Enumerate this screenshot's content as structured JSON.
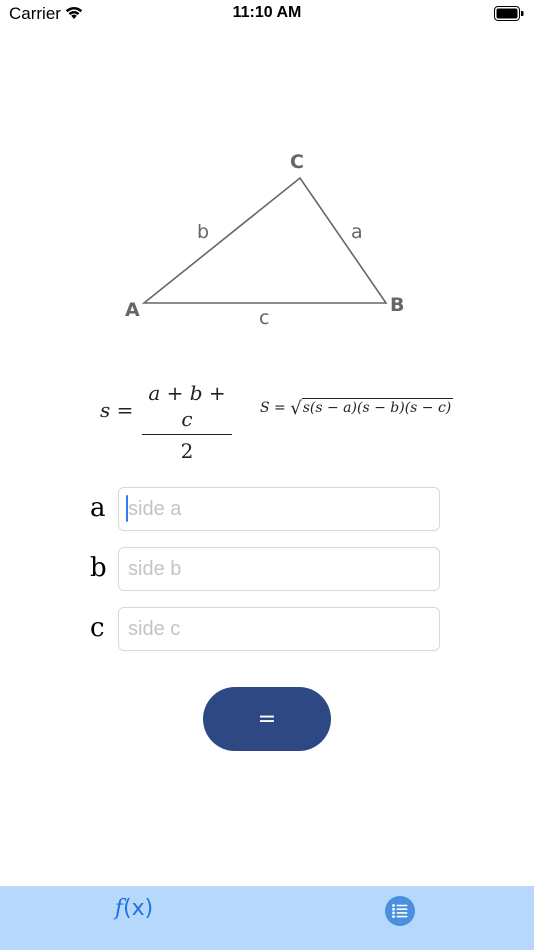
{
  "status_bar": {
    "carrier": "Carrier",
    "time": "11:10 AM",
    "wifi_icon": "wifi-icon",
    "battery_icon": "battery-icon"
  },
  "diagram": {
    "vertex_a": "A",
    "vertex_b": "B",
    "vertex_c": "C",
    "side_a": "a",
    "side_b": "b",
    "side_c": "c",
    "line_color": "#666666"
  },
  "formulas": {
    "semi_perimeter": {
      "lhs": "s =",
      "numerator": "a + b + c",
      "denominator": "2"
    },
    "heron": {
      "lhs": "S =",
      "radicand": "s(s − a)(s − b)(s − c)"
    }
  },
  "inputs": [
    {
      "label": "a",
      "value": "",
      "placeholder": "side a",
      "focused": true
    },
    {
      "label": "b",
      "value": "",
      "placeholder": "side b",
      "focused": false
    },
    {
      "label": "c",
      "value": "",
      "placeholder": "side c",
      "focused": false
    }
  ],
  "equals_button": {
    "label": "=",
    "color": "#2d4882"
  },
  "tab_bar": {
    "background": "#b6d8fb",
    "tabs": [
      {
        "label_f": "f",
        "label_rest": "(x)",
        "icon": "function-icon",
        "active": true,
        "color": "#1f72e0"
      },
      {
        "icon": "list-icon",
        "active": false,
        "color": "#4a8fe0"
      }
    ]
  }
}
